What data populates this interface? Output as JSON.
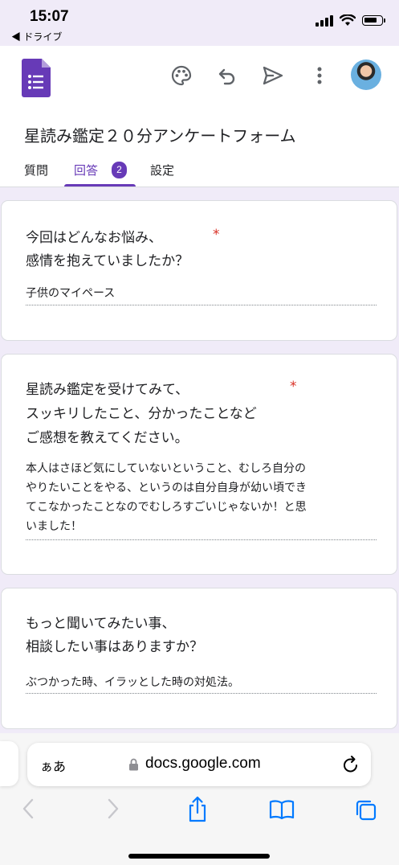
{
  "status": {
    "time": "15:07",
    "back_app": "◀ ドライブ"
  },
  "header": {
    "form_title": "星読み鑑定２０分アンケートフォーム",
    "tabs": [
      {
        "label": "質問",
        "active": false
      },
      {
        "label": "回答",
        "active": true,
        "badge": "2"
      },
      {
        "label": "設定",
        "active": false
      }
    ],
    "icons": [
      "palette-icon",
      "undo-icon",
      "send-icon",
      "more-vert-icon"
    ]
  },
  "responses": [
    {
      "question_line1": "今回はどんなお悩み、",
      "question_line2": "感情を抱えていましたか？",
      "required": "*",
      "answer": "子供のマイペース"
    },
    {
      "question_line1": "星読み鑑定を受けてみて、",
      "question_line2": "スッキリしたこと、分かったことなど",
      "question_line3": "ご感想を教えてください。",
      "required": "*",
      "answer_line1": "本人はさほど気にしていないということ、むしろ自分の",
      "answer_line2": "やりたいことをやる、というのは自分自身が幼い頃でき",
      "answer_line3": "てこなかったことなのでむしろすごいじゃないか！と思",
      "answer_line4": "いました！"
    },
    {
      "question_line1": "もっと聞いてみたい事、",
      "question_line2": "相談したい事はありますか？",
      "answer": "ぶつかった時、イラッとした時の対処法。"
    }
  ],
  "browser": {
    "aa_label": "ぁあ",
    "url": "docs.google.com"
  },
  "colors": {
    "accent": "#673ab7",
    "background": "#f0ebf8",
    "required": "#d93025",
    "ios_blue": "#007aff"
  }
}
